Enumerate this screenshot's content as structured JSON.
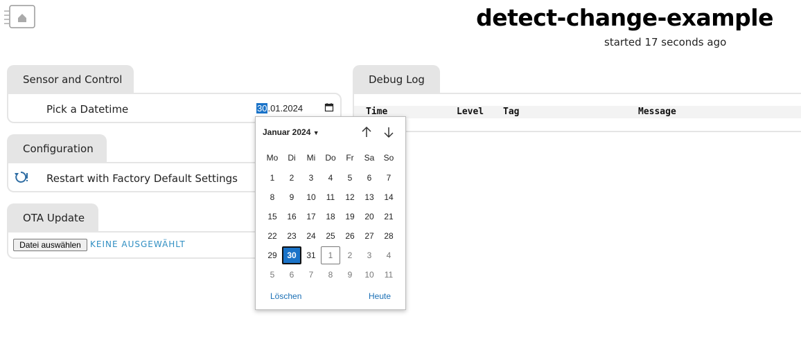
{
  "header": {
    "title": "detect-change-example",
    "subtitle": "started 17 seconds ago"
  },
  "sections": {
    "sensor": {
      "tab_label": "Sensor and Control",
      "datetime_label": "Pick a Datetime",
      "datetime_day": "30",
      "datetime_rest": ".01.2024"
    },
    "config": {
      "tab_label": "Configuration",
      "restart_label": "Restart with Factory Default Settings"
    },
    "ota": {
      "tab_label": "OTA Update",
      "file_button": "Datei auswählen",
      "file_status": "KEINE AUSGEWÄHLT"
    },
    "debug": {
      "tab_label": "Debug Log",
      "columns": [
        "Time",
        "Level",
        "Tag",
        "Message"
      ]
    }
  },
  "calendar": {
    "month_label": "Januar 2024",
    "weekdays": [
      "Mo",
      "Di",
      "Mi",
      "Do",
      "Fr",
      "Sa",
      "So"
    ],
    "weeks": [
      [
        "1",
        "2",
        "3",
        "4",
        "5",
        "6",
        "7"
      ],
      [
        "8",
        "9",
        "10",
        "11",
        "12",
        "13",
        "14"
      ],
      [
        "15",
        "16",
        "17",
        "18",
        "19",
        "20",
        "21"
      ],
      [
        "22",
        "23",
        "24",
        "25",
        "26",
        "27",
        "28"
      ],
      [
        "29",
        "30",
        "31",
        "1",
        "2",
        "3",
        "4"
      ],
      [
        "5",
        "6",
        "7",
        "8",
        "9",
        "10",
        "11"
      ]
    ],
    "selected_day": "30",
    "today_day": "1",
    "clear_label": "Löschen",
    "today_label": "Heute"
  },
  "colors": {
    "accent": "#1a73c8",
    "tab_bg": "#e5e5e5",
    "link": "#2f8ec2"
  }
}
